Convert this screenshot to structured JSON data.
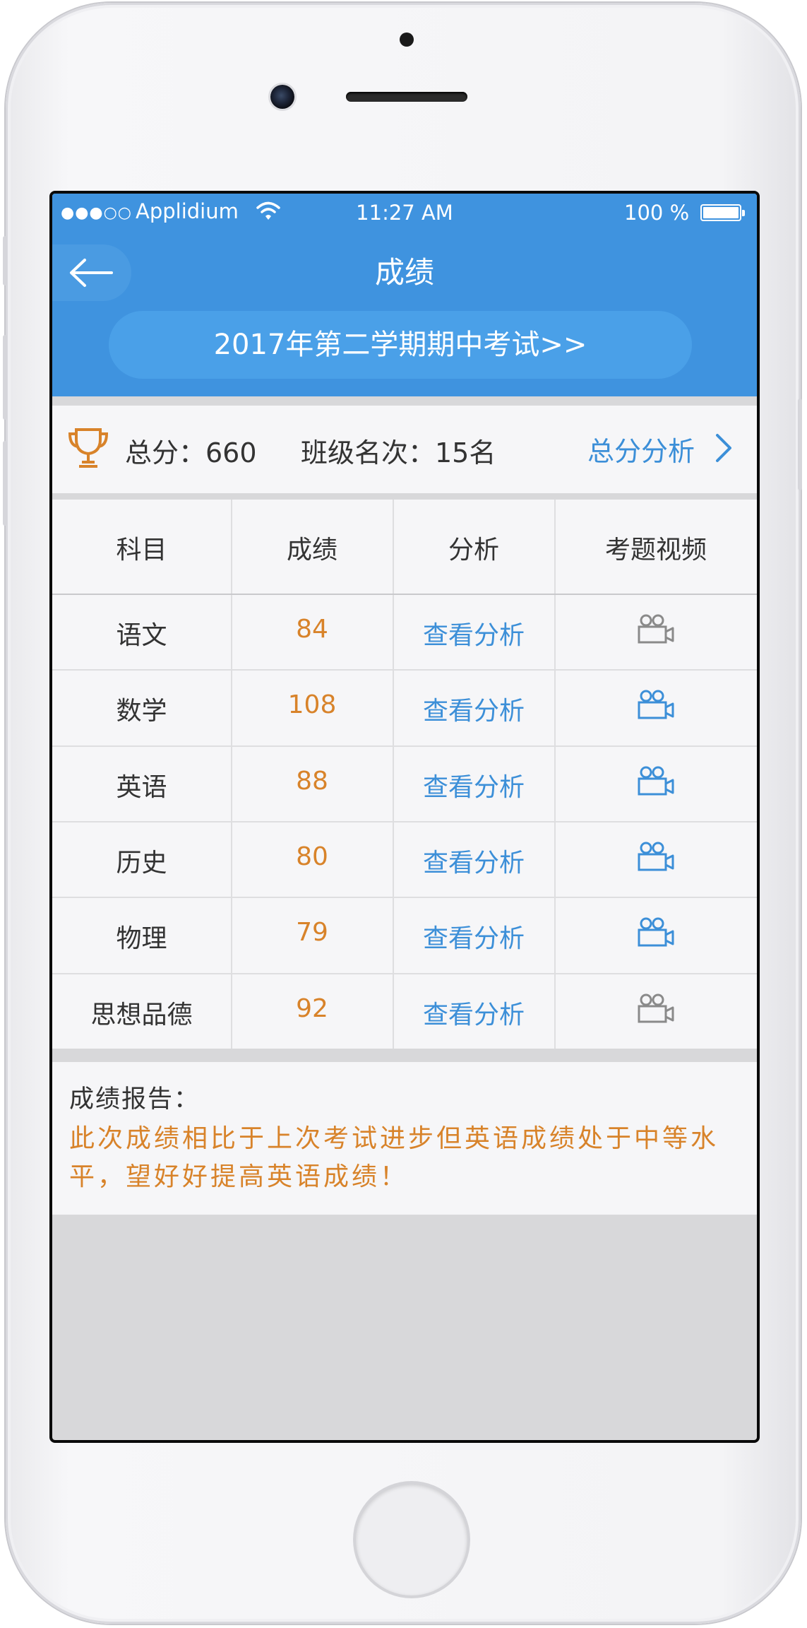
{
  "status_bar": {
    "signal": "●●●○○",
    "carrier": "Applidium",
    "time": "11:27 AM",
    "battery_pct": "100 %"
  },
  "header": {
    "title": "成绩",
    "exam": "2017年第二学期期中考试>>"
  },
  "summary": {
    "total": "总分：660",
    "rank": "班级名次：15名",
    "analysis_link": "总分分析"
  },
  "table": {
    "headers": [
      "科目",
      "成绩",
      "分析",
      "考题视频"
    ],
    "rows": [
      {
        "subject": "语文",
        "score": "84",
        "analysis": "查看分析",
        "video_available": false
      },
      {
        "subject": "数学",
        "score": "108",
        "analysis": "查看分析",
        "video_available": true
      },
      {
        "subject": "英语",
        "score": "88",
        "analysis": "查看分析",
        "video_available": true
      },
      {
        "subject": "历史",
        "score": "80",
        "analysis": "查看分析",
        "video_available": true
      },
      {
        "subject": "物理",
        "score": "79",
        "analysis": "查看分析",
        "video_available": true
      },
      {
        "subject": "思想品德",
        "score": "92",
        "analysis": "查看分析",
        "video_available": false
      }
    ]
  },
  "report": {
    "label": "成绩报告：",
    "text": "此次成绩相比于上次考试进步但英语成绩处于中等水平，望好好提高英语成绩！"
  },
  "colors": {
    "header_blue": "#3f93df",
    "score_orange": "#d8832a",
    "link_blue": "#3c8fd8",
    "video_gray": "#8a8a8a"
  },
  "icons": {
    "back": "arrow-left-icon",
    "trophy": "trophy-icon",
    "chevron": "chevron-right-icon",
    "video": "video-camera-icon"
  }
}
